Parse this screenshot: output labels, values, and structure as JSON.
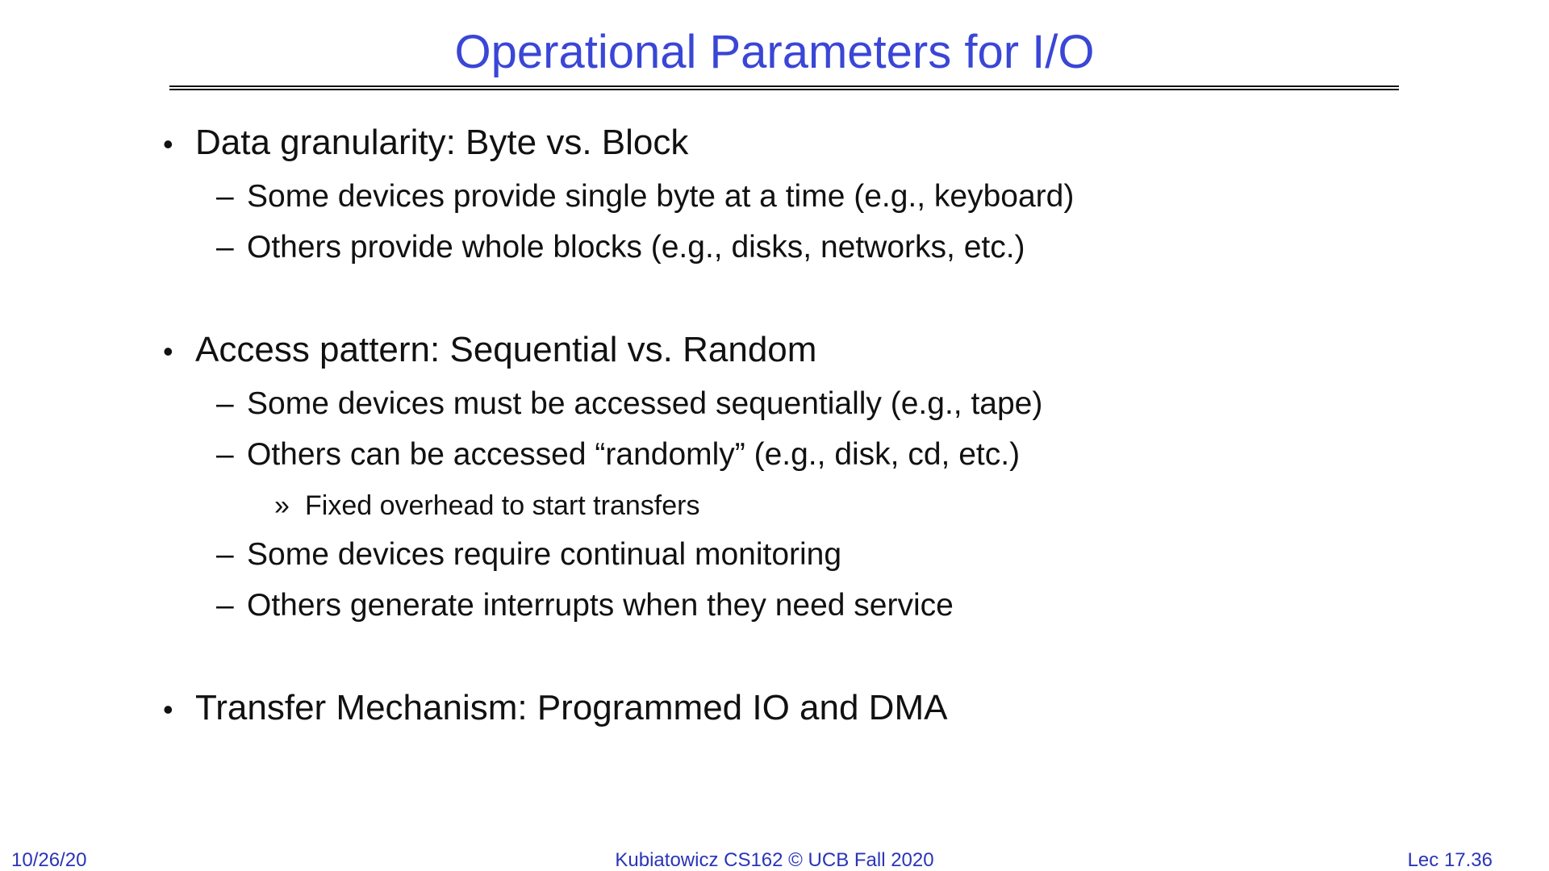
{
  "slide": {
    "title": "Operational Parameters for I/O",
    "bullets": [
      {
        "marker": "•",
        "text": "Data granularity: Byte vs. Block",
        "subitems": [
          {
            "marker": "–",
            "text": "Some devices provide single byte at a time (e.g., keyboard)"
          },
          {
            "marker": "–",
            "text": "Others provide whole blocks (e.g., disks, networks, etc.)"
          }
        ]
      },
      {
        "marker": "•",
        "text": "Access pattern: Sequential vs. Random",
        "subitems": [
          {
            "marker": "–",
            "text": "Some devices must be accessed sequentially (e.g., tape)"
          },
          {
            "marker": "–",
            "text": "Others can be accessed “randomly” (e.g., disk, cd, etc.)",
            "subitems": [
              {
                "marker": "»",
                "text": "Fixed overhead to start transfers"
              }
            ]
          },
          {
            "marker": "–",
            "text": "Some devices require continual monitoring"
          },
          {
            "marker": "–",
            "text": "Others generate interrupts when they need service"
          }
        ]
      },
      {
        "marker": "•",
        "text": "Transfer Mechanism: Programmed IO and DMA",
        "subitems": []
      }
    ]
  },
  "footer": {
    "date": "10/26/20",
    "course": "Kubiatowicz CS162 © UCB Fall 2020",
    "lecture": "Lec 17.36"
  },
  "colors": {
    "title": "#3a46d6",
    "footer": "#2a34b8",
    "body_text": "#111111",
    "background": "#ffffff"
  }
}
